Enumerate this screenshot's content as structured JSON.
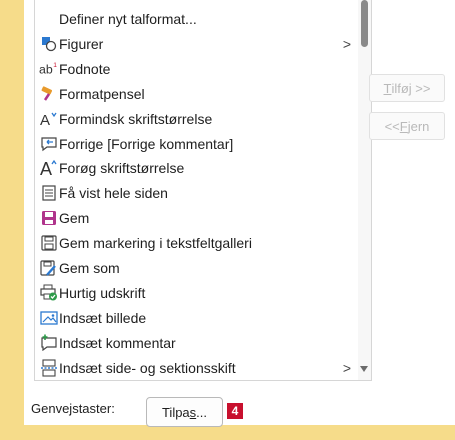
{
  "list": {
    "items": [
      {
        "label": "Definer nyt talformat...",
        "icon": "none",
        "submenu": false
      },
      {
        "label": "Figurer",
        "icon": "shapes-icon",
        "submenu": true
      },
      {
        "label": "Fodnote",
        "icon": "footnote-icon",
        "submenu": false
      },
      {
        "label": "Formatpensel",
        "icon": "format-painter-icon",
        "submenu": false
      },
      {
        "label": "Formindsk skriftstørrelse",
        "icon": "decrease-font-icon",
        "submenu": false
      },
      {
        "label": "Forrige [Forrige kommentar]",
        "icon": "previous-comment-icon",
        "submenu": false
      },
      {
        "label": "Forøg skriftstørrelse",
        "icon": "increase-font-icon",
        "submenu": false
      },
      {
        "label": "Få vist hele siden",
        "icon": "full-page-icon",
        "submenu": false
      },
      {
        "label": "Gem",
        "icon": "save-icon",
        "submenu": false
      },
      {
        "label": "Gem markering i tekstfeltgalleri",
        "icon": "save-selection-icon",
        "submenu": false
      },
      {
        "label": "Gem som",
        "icon": "save-as-icon",
        "submenu": false
      },
      {
        "label": "Hurtig udskrift",
        "icon": "quick-print-icon",
        "submenu": false
      },
      {
        "label": "Indsæt billede",
        "icon": "insert-picture-icon",
        "submenu": false
      },
      {
        "label": "Indsæt kommentar",
        "icon": "insert-comment-icon",
        "submenu": false
      },
      {
        "label": "Indsæt side- og sektionsskift",
        "icon": "page-break-icon",
        "submenu": true
      }
    ],
    "submenu_arrow": ">"
  },
  "buttons": {
    "add_prefix": "",
    "add_key": "T",
    "add_rest": "ilføj >>",
    "remove_prefix": "<< ",
    "remove_key": "F",
    "remove_rest": "jern"
  },
  "footer": {
    "shortcut_label": "Genvejstaster:",
    "customize_prefix": "Tilpa",
    "customize_key": "s",
    "customize_suffix": "...",
    "badge": "4"
  },
  "colors": {
    "background": "#f6dc8a",
    "badge": "#c8102e",
    "accent_blue": "#2b79d0",
    "accent_purple": "#b0348c"
  }
}
